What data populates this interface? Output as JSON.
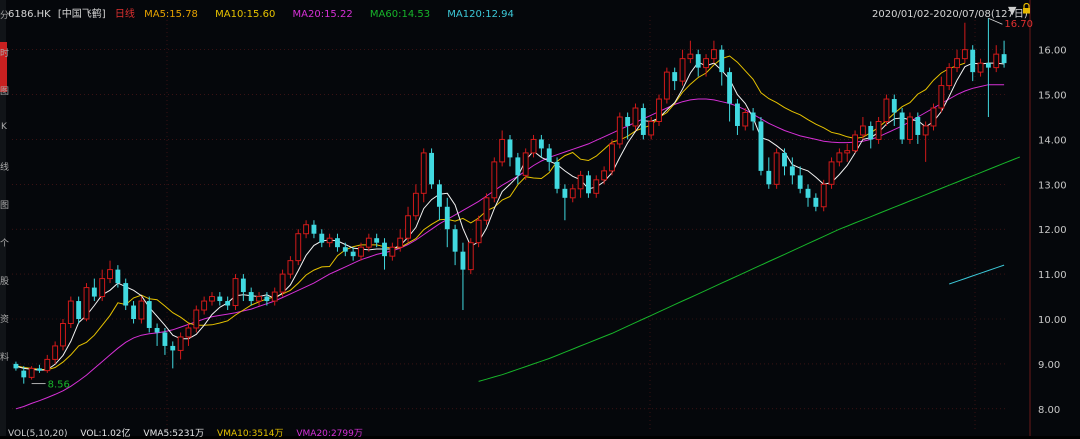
{
  "header": {
    "code": "6186.HK",
    "name": "[中国飞鹤]",
    "period": "日线",
    "ma5": "MA5:15.78",
    "ma10": "MA10:15.60",
    "ma20": "MA20:15.22",
    "ma60": "MA60:14.53",
    "ma120": "MA120:12.94",
    "date_range": "2020/01/02-2020/07/08(127日)"
  },
  "colors": {
    "background": "#05070b",
    "up": "#d11a1a",
    "down": "#41d9e0",
    "ma5": "#f3f3f3",
    "ma10": "#e6c200",
    "ma20": "#d630d6",
    "ma60": "#17b52a",
    "ma120": "#3cc8d8",
    "grid": "#5a1a1a",
    "axis_text": "#c8c8c8"
  },
  "sidebar": {
    "chars": [
      "分",
      "时",
      "图",
      "K",
      "线",
      "图",
      "个",
      "股",
      "资",
      "料"
    ]
  },
  "bottom": {
    "vol": "VOL(5,10,20)",
    "vol_value": "VOL:1.02亿",
    "vma5": "VMA5:5231万",
    "vma10": "VMA10:3514万",
    "vma20": "VMA20:2799万"
  },
  "chart_data": {
    "type": "candlestick",
    "title": "",
    "xlabel": "",
    "ylabel": "",
    "ylim": [
      7.75,
      16.75
    ],
    "y_ticks": [
      "16.00",
      "15.00",
      "14.00",
      "13.00",
      "12.00",
      "11.00",
      "10.00",
      "9.00",
      "8.00"
    ],
    "annotations": [
      {
        "text": "16.70",
        "index": 124,
        "price": 16.7
      },
      {
        "text": "8.56",
        "index": 2,
        "price": 8.56
      }
    ],
    "candles": [
      [
        9.0,
        8.9,
        9.05,
        8.85
      ],
      [
        8.85,
        8.7,
        8.95,
        8.56
      ],
      [
        8.7,
        8.9,
        8.95,
        8.65
      ],
      [
        8.9,
        8.85,
        8.98,
        8.8
      ],
      [
        8.85,
        9.1,
        9.2,
        8.8
      ],
      [
        9.1,
        9.4,
        9.5,
        9.0
      ],
      [
        9.4,
        9.9,
        10.0,
        9.3
      ],
      [
        9.9,
        10.4,
        10.5,
        9.8
      ],
      [
        10.4,
        10.0,
        10.5,
        9.9
      ],
      [
        10.0,
        10.7,
        10.8,
        9.95
      ],
      [
        10.7,
        10.5,
        10.9,
        10.4
      ],
      [
        10.5,
        10.9,
        11.1,
        10.4
      ],
      [
        10.9,
        11.1,
        11.3,
        10.8
      ],
      [
        11.1,
        10.8,
        11.2,
        10.7
      ],
      [
        10.8,
        10.3,
        10.9,
        10.2
      ],
      [
        10.3,
        10.0,
        10.4,
        9.9
      ],
      [
        10.0,
        10.4,
        10.5,
        9.9
      ],
      [
        10.4,
        9.8,
        10.5,
        9.7
      ],
      [
        9.8,
        9.7,
        9.9,
        9.4
      ],
      [
        9.7,
        9.4,
        9.8,
        9.2
      ],
      [
        9.4,
        9.3,
        9.5,
        8.9
      ],
      [
        9.3,
        9.6,
        9.7,
        9.1
      ],
      [
        9.6,
        9.8,
        9.9,
        9.4
      ],
      [
        9.8,
        10.2,
        10.3,
        9.7
      ],
      [
        10.2,
        10.4,
        10.5,
        10.1
      ],
      [
        10.4,
        10.5,
        10.6,
        10.3
      ],
      [
        10.5,
        10.4,
        10.6,
        10.3
      ],
      [
        10.4,
        10.3,
        10.5,
        10.2
      ],
      [
        10.3,
        10.9,
        11.0,
        10.2
      ],
      [
        10.9,
        10.6,
        11.0,
        10.4
      ],
      [
        10.6,
        10.4,
        10.7,
        10.3
      ],
      [
        10.4,
        10.5,
        10.6,
        10.3
      ],
      [
        10.5,
        10.4,
        10.6,
        10.3
      ],
      [
        10.4,
        10.6,
        10.7,
        10.3
      ],
      [
        10.6,
        11.0,
        11.1,
        10.5
      ],
      [
        11.0,
        11.3,
        11.4,
        10.9
      ],
      [
        11.3,
        11.9,
        12.0,
        11.2
      ],
      [
        11.9,
        12.1,
        12.2,
        11.8
      ],
      [
        12.1,
        11.9,
        12.2,
        11.8
      ],
      [
        11.9,
        11.7,
        12.0,
        11.6
      ],
      [
        11.7,
        11.8,
        11.9,
        11.6
      ],
      [
        11.8,
        11.6,
        11.9,
        11.5
      ],
      [
        11.6,
        11.5,
        11.7,
        11.4
      ],
      [
        11.5,
        11.4,
        11.6,
        11.3
      ],
      [
        11.4,
        11.6,
        11.7,
        11.3
      ],
      [
        11.6,
        11.8,
        11.9,
        11.5
      ],
      [
        11.8,
        11.7,
        11.9,
        11.6
      ],
      [
        11.7,
        11.4,
        11.8,
        11.1
      ],
      [
        11.4,
        11.6,
        11.7,
        11.3
      ],
      [
        11.6,
        11.8,
        12.0,
        11.5
      ],
      [
        11.8,
        12.3,
        12.5,
        11.7
      ],
      [
        12.3,
        12.8,
        13.0,
        12.2
      ],
      [
        12.8,
        13.7,
        13.8,
        12.6
      ],
      [
        13.7,
        13.0,
        13.8,
        12.9
      ],
      [
        13.0,
        12.5,
        13.1,
        12.2
      ],
      [
        12.5,
        12.0,
        12.7,
        11.6
      ],
      [
        12.0,
        11.5,
        12.1,
        11.2
      ],
      [
        11.5,
        11.1,
        11.7,
        10.2
      ],
      [
        11.1,
        11.7,
        11.8,
        11.0
      ],
      [
        11.7,
        12.2,
        12.3,
        11.6
      ],
      [
        12.2,
        12.7,
        12.8,
        12.1
      ],
      [
        12.7,
        13.5,
        13.6,
        12.6
      ],
      [
        13.5,
        14.0,
        14.2,
        13.4
      ],
      [
        14.0,
        13.6,
        14.1,
        13.4
      ],
      [
        13.6,
        13.2,
        13.7,
        13.0
      ],
      [
        13.2,
        13.7,
        13.8,
        13.1
      ],
      [
        13.7,
        14.0,
        14.1,
        13.6
      ],
      [
        14.0,
        13.8,
        14.1,
        13.6
      ],
      [
        13.8,
        13.5,
        13.9,
        13.3
      ],
      [
        13.5,
        12.9,
        13.6,
        12.8
      ],
      [
        12.9,
        12.7,
        13.0,
        12.2
      ],
      [
        12.7,
        12.9,
        13.0,
        12.6
      ],
      [
        12.9,
        13.2,
        13.3,
        12.7
      ],
      [
        13.2,
        12.8,
        13.3,
        12.7
      ],
      [
        12.8,
        13.1,
        13.2,
        12.7
      ],
      [
        13.1,
        13.3,
        13.4,
        13.0
      ],
      [
        13.3,
        13.9,
        14.0,
        13.2
      ],
      [
        13.9,
        14.5,
        14.6,
        13.8
      ],
      [
        14.5,
        14.3,
        14.6,
        14.0
      ],
      [
        14.3,
        14.7,
        14.8,
        14.2
      ],
      [
        14.7,
        14.1,
        14.8,
        14.0
      ],
      [
        14.1,
        14.4,
        14.5,
        14.0
      ],
      [
        14.4,
        14.9,
        15.0,
        14.3
      ],
      [
        14.9,
        15.5,
        15.6,
        14.8
      ],
      [
        15.5,
        15.3,
        15.6,
        15.1
      ],
      [
        15.3,
        15.8,
        16.0,
        15.2
      ],
      [
        15.8,
        15.9,
        16.2,
        15.7
      ],
      [
        15.9,
        15.6,
        16.0,
        15.4
      ],
      [
        15.6,
        15.8,
        15.9,
        15.4
      ],
      [
        15.8,
        16.0,
        16.2,
        15.7
      ],
      [
        16.0,
        15.5,
        16.1,
        15.2
      ],
      [
        15.5,
        14.8,
        15.6,
        14.4
      ],
      [
        14.8,
        14.3,
        14.9,
        14.1
      ],
      [
        14.3,
        14.6,
        14.7,
        14.2
      ],
      [
        14.6,
        14.4,
        14.7,
        14.2
      ],
      [
        14.4,
        13.3,
        14.5,
        13.2
      ],
      [
        13.3,
        13.0,
        13.6,
        12.9
      ],
      [
        13.0,
        13.7,
        13.8,
        12.9
      ],
      [
        13.7,
        13.4,
        13.8,
        13.2
      ],
      [
        13.4,
        13.2,
        13.6,
        13.0
      ],
      [
        13.2,
        12.9,
        13.4,
        12.8
      ],
      [
        12.9,
        12.7,
        13.0,
        12.5
      ],
      [
        12.7,
        12.5,
        12.8,
        12.4
      ],
      [
        12.5,
        13.0,
        13.1,
        12.4
      ],
      [
        13.0,
        13.5,
        13.6,
        12.9
      ],
      [
        13.5,
        13.7,
        13.8,
        13.4
      ],
      [
        13.7,
        13.75,
        13.9,
        13.5
      ],
      [
        13.75,
        14.1,
        14.2,
        13.7
      ],
      [
        14.1,
        14.3,
        14.5,
        14.0
      ],
      [
        14.3,
        14.0,
        14.4,
        13.8
      ],
      [
        14.0,
        14.4,
        14.5,
        13.9
      ],
      [
        14.4,
        14.9,
        15.0,
        14.3
      ],
      [
        14.9,
        14.6,
        15.0,
        14.3
      ],
      [
        14.6,
        14.0,
        14.7,
        13.9
      ],
      [
        14.0,
        14.5,
        14.6,
        13.9
      ],
      [
        14.5,
        14.1,
        14.6,
        13.9
      ],
      [
        14.1,
        14.3,
        14.4,
        13.5
      ],
      [
        14.3,
        14.7,
        14.8,
        14.2
      ],
      [
        14.7,
        15.2,
        15.4,
        14.6
      ],
      [
        15.2,
        15.6,
        15.7,
        15.1
      ],
      [
        15.6,
        15.8,
        16.0,
        15.5
      ],
      [
        15.8,
        16.0,
        16.6,
        15.7
      ],
      [
        16.0,
        15.5,
        16.1,
        15.3
      ],
      [
        15.5,
        15.7,
        15.8,
        15.4
      ],
      [
        15.7,
        15.6,
        16.7,
        14.5
      ],
      [
        15.6,
        15.9,
        16.1,
        15.5
      ],
      [
        15.9,
        15.7,
        16.2,
        15.6
      ]
    ],
    "ma5": [
      8.95,
      8.9,
      8.88,
      8.86,
      8.87,
      8.99,
      9.19,
      9.5,
      9.92,
      10.08,
      10.3,
      10.54,
      10.64,
      10.8,
      10.72,
      10.64,
      10.52,
      10.26,
      10.06,
      9.86,
      9.64,
      9.56,
      9.56,
      9.66,
      9.86,
      10.1,
      10.26,
      10.36,
      10.52,
      10.54,
      10.52,
      10.5,
      10.54,
      10.46,
      10.58,
      10.76,
      11.08,
      11.42,
      11.64,
      11.74,
      11.76,
      11.74,
      11.66,
      11.58,
      11.56,
      11.54,
      11.56,
      11.56,
      11.56,
      11.64,
      11.82,
      12.04,
      12.46,
      12.66,
      12.78,
      12.8,
      12.54,
      12.02,
      11.62,
      11.72,
      12.02,
      12.46,
      12.84,
      13.0,
      13.18,
      13.54,
      13.74,
      13.6,
      13.52,
      13.44,
      13.3,
      13.18,
      13.1,
      12.9,
      12.94,
      13.06,
      13.26,
      13.6,
      13.92,
      14.18,
      14.42,
      14.4,
      14.48,
      14.66,
      14.82,
      15.12,
      15.48,
      15.72,
      15.64,
      15.7,
      15.54,
      15.34,
      15.0,
      14.8,
      14.48,
      14.04,
      13.98,
      13.86,
      13.72,
      13.44,
      13.36,
      13.3,
      13.16,
      13.0,
      13.04,
      13.22,
      13.42,
      13.7,
      14.0,
      14.04,
      14.16,
      14.34,
      14.46,
      14.48,
      14.44,
      14.42,
      14.28,
      14.4,
      14.62,
      14.96,
      15.32,
      15.62,
      15.7,
      15.68,
      15.7,
      15.7,
      15.68
    ],
    "ma10": [
      8.96,
      8.92,
      8.9,
      8.88,
      8.87,
      8.92,
      9.04,
      9.2,
      9.4,
      9.48,
      9.64,
      9.86,
      10.08,
      10.36,
      10.32,
      10.47,
      10.53,
      10.45,
      10.43,
      10.29,
      10.14,
      10.04,
      9.91,
      9.86,
      9.86,
      9.87,
      9.91,
      9.96,
      10.09,
      10.2,
      10.31,
      10.38,
      10.45,
      10.49,
      10.56,
      10.64,
      10.8,
      10.98,
      11.09,
      11.16,
      11.17,
      11.41,
      11.54,
      11.61,
      11.65,
      11.65,
      11.65,
      11.61,
      11.57,
      11.59,
      11.69,
      11.79,
      11.99,
      12.11,
      12.21,
      12.22,
      12.18,
      12.24,
      12.14,
      12.25,
      12.41,
      12.49,
      12.65,
      12.73,
      12.99,
      13.17,
      13.14,
      13.13,
      13.26,
      13.51,
      13.64,
      13.71,
      13.56,
      13.53,
      13.63,
      13.78,
      13.94,
      13.99,
      14.07,
      14.19,
      14.26,
      14.32,
      14.49,
      14.6,
      14.8,
      15.05,
      15.23,
      15.38,
      15.48,
      15.66,
      15.8,
      15.86,
      15.72,
      15.53,
      15.34,
      15.04,
      14.91,
      14.82,
      14.71,
      14.62,
      14.55,
      14.44,
      14.34,
      14.26,
      14.16,
      14.12,
      14.06,
      14.02,
      14.05,
      14.15,
      14.27,
      14.42,
      14.58,
      14.73,
      14.82,
      15.01,
      15.11,
      15.32,
      15.48,
      15.58,
      15.64,
      15.7
    ],
    "ma20": [
      8.0,
      8.05,
      8.12,
      8.18,
      8.25,
      8.32,
      8.4,
      8.5,
      8.62,
      8.75,
      8.9,
      9.05,
      9.2,
      9.35,
      9.48,
      9.58,
      9.64,
      9.67,
      9.69,
      9.72,
      9.76,
      9.82,
      9.88,
      9.94,
      10.0,
      10.05,
      10.08,
      10.11,
      10.14,
      10.18,
      10.22,
      10.28,
      10.34,
      10.4,
      10.48,
      10.56,
      10.64,
      10.72,
      10.8,
      10.9,
      11.0,
      11.08,
      11.16,
      11.24,
      11.32,
      11.38,
      11.44,
      11.48,
      11.52,
      11.58,
      11.66,
      11.76,
      11.88,
      12.0,
      12.12,
      12.22,
      12.32,
      12.42,
      12.52,
      12.62,
      12.74,
      12.86,
      12.98,
      13.08,
      13.18,
      13.3,
      13.42,
      13.52,
      13.6,
      13.66,
      13.72,
      13.78,
      13.84,
      13.9,
      13.98,
      14.06,
      14.14,
      14.22,
      14.3,
      14.38,
      14.46,
      14.54,
      14.62,
      14.7,
      14.78,
      14.84,
      14.88,
      14.9,
      14.9,
      14.88,
      14.84,
      14.8,
      14.74,
      14.66,
      14.56,
      14.46,
      14.36,
      14.28,
      14.2,
      14.14,
      14.08,
      14.04,
      14.0,
      13.96,
      13.94,
      13.93,
      13.93,
      13.94,
      13.96,
      14.0,
      14.06,
      14.14,
      14.22,
      14.3,
      14.4,
      14.5,
      14.6,
      14.7,
      14.8,
      14.9,
      15.0,
      15.08,
      15.14,
      15.18,
      15.22,
      15.22,
      15.22
    ],
    "ma60_start_index": 59,
    "ma60": [
      8.61,
      8.66,
      8.71,
      8.76,
      8.82,
      8.88,
      8.94,
      9.0,
      9.06,
      9.12,
      9.19,
      9.26,
      9.33,
      9.4,
      9.47,
      9.54,
      9.61,
      9.68,
      9.76,
      9.84,
      9.92,
      10.0,
      10.08,
      10.16,
      10.24,
      10.32,
      10.4,
      10.48,
      10.56,
      10.64,
      10.72,
      10.8,
      10.88,
      10.96,
      11.04,
      11.12,
      11.2,
      11.28,
      11.36,
      11.44,
      11.52,
      11.6,
      11.68,
      11.76,
      11.84,
      11.92,
      12.0,
      12.07,
      12.14,
      12.21,
      12.28,
      12.35,
      12.42,
      12.49,
      12.56,
      12.63,
      12.7,
      12.77,
      12.84,
      12.91,
      12.98,
      13.05,
      13.12,
      13.19,
      13.26,
      13.33,
      13.4,
      13.47,
      13.54,
      13.61
    ],
    "ma120_start_index": 119,
    "ma120": [
      10.78,
      10.84,
      10.9,
      10.96,
      11.02,
      11.08,
      11.14,
      11.2
    ]
  }
}
